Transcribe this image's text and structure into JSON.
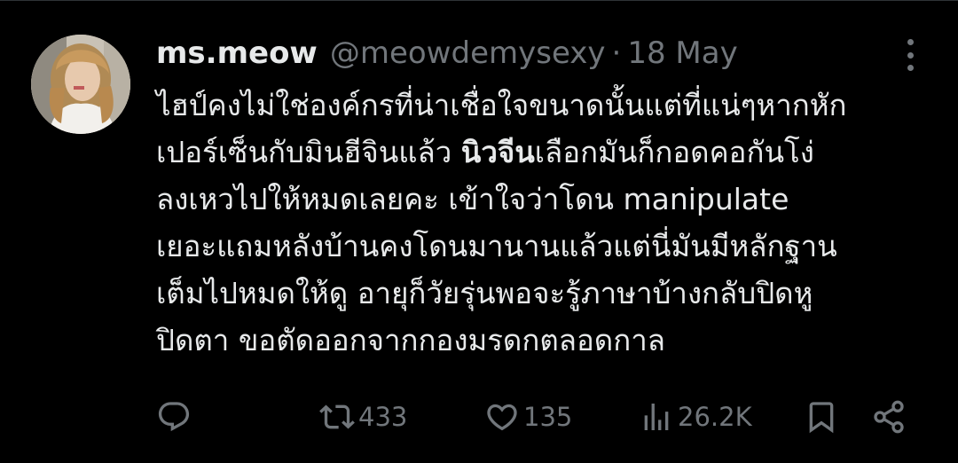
{
  "author": {
    "display_name": "ms.meow",
    "handle": "@meowdemysexy",
    "separator": "·",
    "date": "18 May"
  },
  "tweet": {
    "lines": [
      {
        "segments": [
          {
            "text": "ไฮป์คงไม่ใช่องค์กรที่น่าเชื่อใจขนาดนั้นแต่ที่แน่ๆหากหัก",
            "bold": false
          }
        ]
      },
      {
        "segments": [
          {
            "text": "เปอร์เซ็นกับมินฮีจินแล้ว ",
            "bold": false
          },
          {
            "text": "นิวจีน",
            "bold": true
          },
          {
            "text": "เลือกมันก็กอดคอกันโง่",
            "bold": false
          }
        ]
      },
      {
        "segments": [
          {
            "text": "ลงเหวไปให้หมดเลยคะ เข้าใจว่าโดน manipulate",
            "bold": false
          }
        ]
      },
      {
        "segments": [
          {
            "text": "เยอะแถมหลังบ้านคงโดนมานานแล้วแต่นี่มันมีหลักฐาน",
            "bold": false
          }
        ]
      },
      {
        "segments": [
          {
            "text": "เต็มไปหมดให้ดู อายุก็วัยรุ่นพอจะรู้ภาษาบ้างกลับปิดหู",
            "bold": false
          }
        ]
      },
      {
        "segments": [
          {
            "text": "ปิดตา ขอตัดออกจากกองมรดกตลอดกาล",
            "bold": false
          }
        ]
      }
    ]
  },
  "actions": {
    "reply": {
      "icon": "reply-icon",
      "count": ""
    },
    "retweet": {
      "icon": "retweet-icon",
      "count": "433"
    },
    "like": {
      "icon": "heart-icon",
      "count": "135"
    },
    "views": {
      "icon": "views-icon",
      "count": "26.2K"
    },
    "bookmark": {
      "icon": "bookmark-icon"
    },
    "share": {
      "icon": "share-icon"
    }
  },
  "colors": {
    "background": "#000000",
    "text": "#e7e9ea",
    "muted": "#71767b"
  }
}
